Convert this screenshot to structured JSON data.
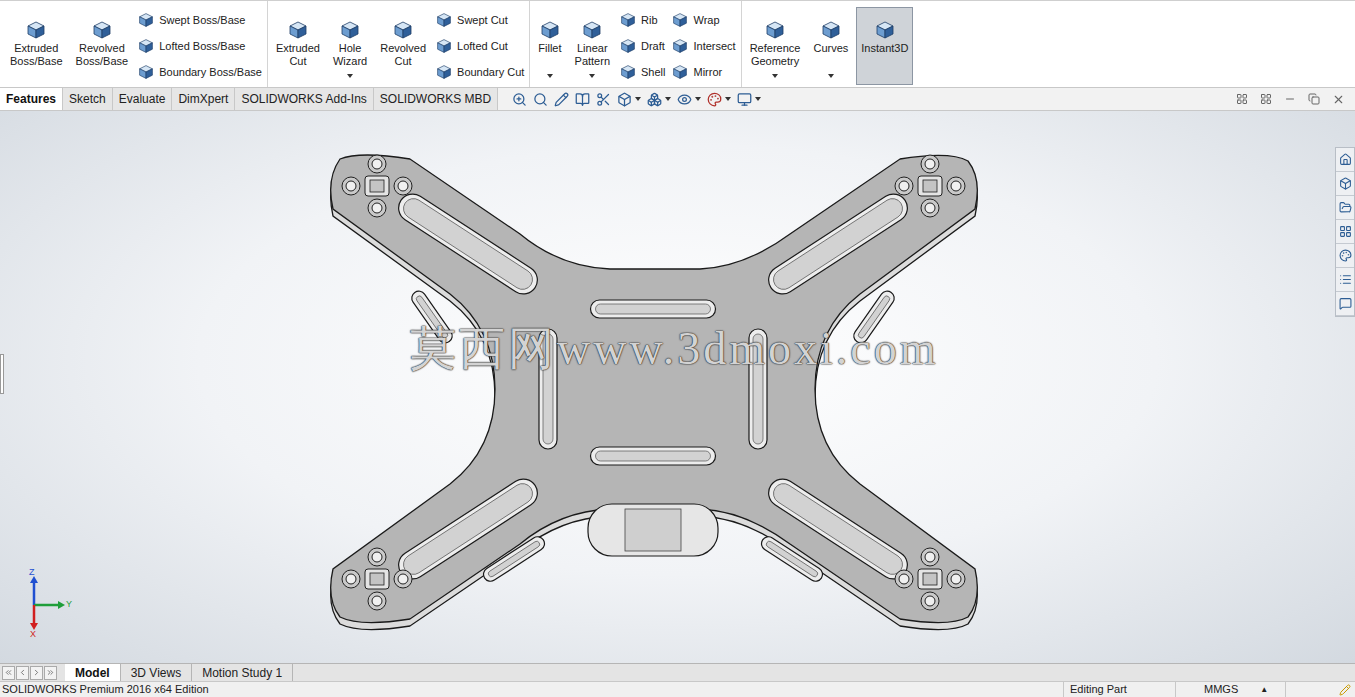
{
  "ribbon": {
    "groups": [
      {
        "items": [
          {
            "kind": "large",
            "label": [
              "Extruded",
              "Boss/Base"
            ],
            "dropdown": false,
            "selected": false
          },
          {
            "kind": "large",
            "label": [
              "Revolved",
              "Boss/Base"
            ],
            "dropdown": false,
            "selected": false
          },
          {
            "kind": "stack",
            "items": [
              {
                "label": "Swept Boss/Base"
              },
              {
                "label": "Lofted Boss/Base"
              },
              {
                "label": "Boundary Boss/Base"
              }
            ]
          }
        ]
      },
      {
        "items": [
          {
            "kind": "large",
            "label": [
              "Extruded",
              "Cut"
            ],
            "dropdown": false,
            "selected": false
          },
          {
            "kind": "large",
            "label": [
              "Hole",
              "Wizard"
            ],
            "dropdown": true,
            "selected": false
          },
          {
            "kind": "large",
            "label": [
              "Revolved",
              "Cut"
            ],
            "dropdown": false,
            "selected": false
          },
          {
            "kind": "stack",
            "items": [
              {
                "label": "Swept Cut"
              },
              {
                "label": "Lofted Cut"
              },
              {
                "label": "Boundary Cut"
              }
            ]
          }
        ]
      },
      {
        "items": [
          {
            "kind": "large",
            "label": [
              "Fillet"
            ],
            "dropdown": true,
            "selected": false
          },
          {
            "kind": "large",
            "label": [
              "Linear",
              "Pattern"
            ],
            "dropdown": true,
            "selected": false
          },
          {
            "kind": "stack",
            "items": [
              {
                "label": "Rib"
              },
              {
                "label": "Draft"
              },
              {
                "label": "Shell"
              }
            ]
          },
          {
            "kind": "stack",
            "items": [
              {
                "label": "Wrap"
              },
              {
                "label": "Intersect"
              },
              {
                "label": "Mirror"
              }
            ]
          }
        ]
      },
      {
        "items": [
          {
            "kind": "large",
            "label": [
              "Reference",
              "Geometry"
            ],
            "dropdown": true,
            "selected": false
          },
          {
            "kind": "large",
            "label": [
              "Curves"
            ],
            "dropdown": true,
            "selected": false
          },
          {
            "kind": "large",
            "label": [
              "Instant3D"
            ],
            "dropdown": false,
            "selected": true
          }
        ]
      }
    ]
  },
  "command_tabs": [
    {
      "label": "Features",
      "selected": true
    },
    {
      "label": "Sketch",
      "selected": false
    },
    {
      "label": "Evaluate",
      "selected": false
    },
    {
      "label": "DimXpert",
      "selected": false
    },
    {
      "label": "SOLIDWORKS Add-Ins",
      "selected": false
    },
    {
      "label": "SOLIDWORKS MBD",
      "selected": false
    }
  ],
  "viewport": {
    "watermark": "莫西网www.3dmoxi.com",
    "triad": [
      {
        "label": "Z",
        "color": "#1f4fd1"
      },
      {
        "label": "Y",
        "color": "#1f9e3a"
      },
      {
        "label": "X",
        "color": "#d11f1f"
      }
    ]
  },
  "bottom_tabs": [
    {
      "label": "Model",
      "selected": true
    },
    {
      "label": "3D Views",
      "selected": false
    },
    {
      "label": "Motion Study 1",
      "selected": false
    }
  ],
  "status_bar": {
    "edition": "SOLIDWORKS Premium 2016 x64 Edition",
    "mode": "Editing Part",
    "units": "MMGS",
    "units_arrow": "▲"
  }
}
